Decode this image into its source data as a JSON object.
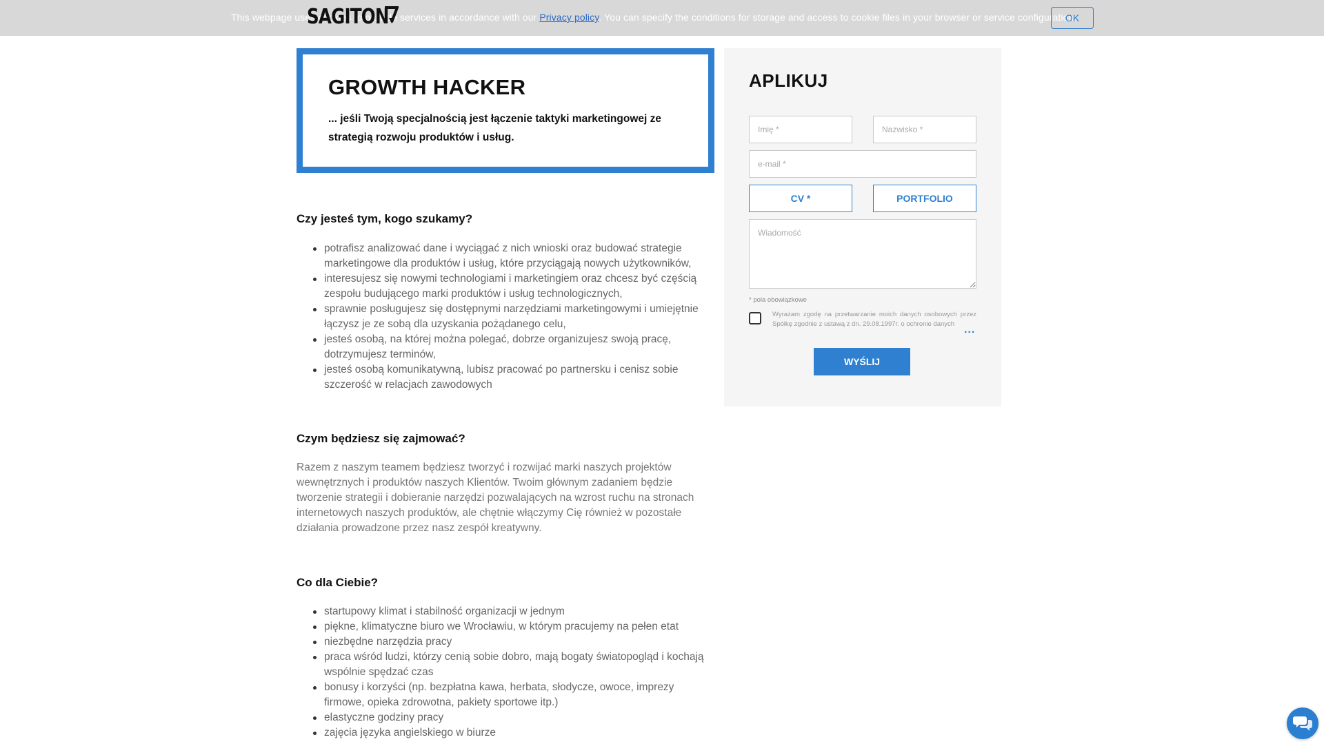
{
  "cookie": {
    "text_before": "This webpage uses cookies to provide services in accordance with our ",
    "link_label": "Privacy policy",
    "text_after": ". You can specify the conditions for storage and access to cookie files in your browser or service configuration.",
    "ok_label": "OK"
  },
  "logo": {
    "text": "SAGITON"
  },
  "job": {
    "title": "GROWTH HACKER",
    "subtitle": "... jeśli Twoją specjalnością jest łączenie taktyki marketingowej ze strategią rozwoju produktów i usług."
  },
  "sections": {
    "who": {
      "heading": "Czy jesteś tym, kogo szukamy?",
      "items": [
        "potrafisz analizować dane i wyciągać z nich wnioski oraz budować strategie marketingowe dla produktów i usług, które przyciągają nowych użytkowników,",
        "interesujesz się nowymi technologiami i marketingiem oraz chcesz być częścią zespołu budującego marki produktów i usług technologicznych,",
        "sprawnie posługujesz się dostępnymi narzędziami marketingowymi i umiejętnie łączysz je ze sobą dla uzyskania pożądanego celu,",
        "jesteś osobą, na której można polegać, dobrze organizujesz swoją pracę, dotrzymujesz terminów,",
        "jesteś osobą komunikatywną, lubisz pracować po partnersku i cenisz sobie szczerość w relacjach zawodowych"
      ]
    },
    "what": {
      "heading": "Czym będziesz się zajmować?",
      "paragraph": "Razem z naszym teamem będziesz tworzyć i rozwijać marki naszych projektów wewnętrznych i produktów naszych Klientów. Twoim głównym zadaniem będzie tworzenie strategii i dobieranie narzędzi pozwalających na wzrost ruchu na stronach internetowych naszych produktów, ale chętnie włączymy Cię również w pozostałe działania prowadzone przez nasz zespół kreatywny."
    },
    "offer": {
      "heading": "Co dla Ciebie?",
      "items": [
        "startupowy klimat i stabilność organizacji w jednym",
        "piękne, klimatyczne biuro we Wrocławiu, w którym pracujemy na pełen etat",
        "niezbędne narzędzia pracy",
        "praca wśród ludzi, którzy cenią sobie dobro, mają bogaty światopogląd i kochają wspólnie spędzać czas",
        "bonusy i korzyści (np. bezpłatna kawa, herbata, słodycze, owoce, imprezy firmowe, opieka zdrowotna, pakiety sportowe itp.)",
        "elastyczne godziny pracy",
        "zajęcia języka angielskiego w biurze"
      ]
    }
  },
  "apply": {
    "title": "APLIKUJ",
    "first_name_placeholder": "Imię *",
    "last_name_placeholder": "Nazwisko *",
    "email_placeholder": "e-mail *",
    "cv_label": "CV *",
    "portfolio_label": "PORTFOLIO",
    "message_placeholder": "Wiadomość",
    "required_note": "* pola obowiązkowe",
    "consent_text": "Wyrażam zgodę na przetwarzanie moich danych osobowych przez Spółkę zgodnie z ustawą z dn. 29.08.1997r. o ochronie danych",
    "consent_more": "...",
    "submit_label": "WYŚLIJ"
  },
  "colors": {
    "accent": "#2f80d1",
    "cookie_bar": "#d8d8d8",
    "panel": "#f5f5f5"
  },
  "icons": {
    "chat": "chat-bubbles-icon",
    "logo_mark": "arrow-7-icon"
  }
}
